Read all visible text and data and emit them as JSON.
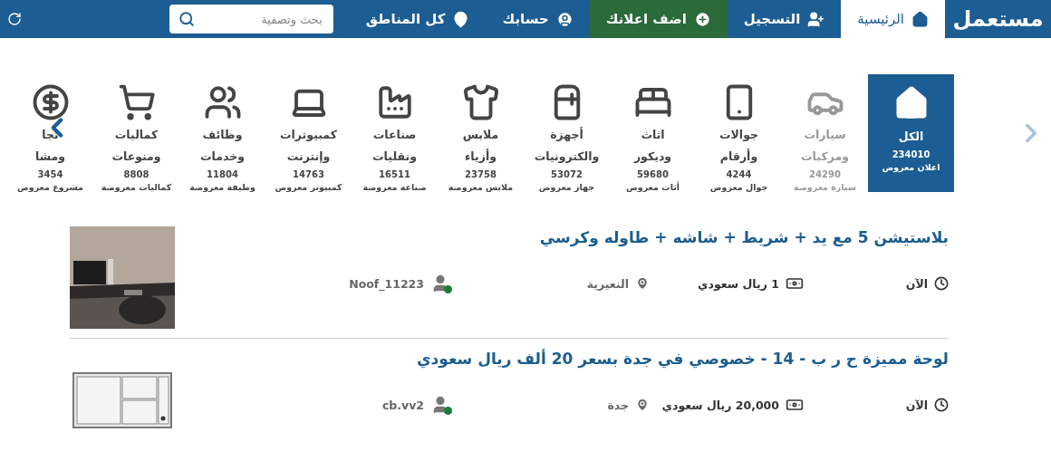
{
  "navbar": {
    "logo": "مستعمل",
    "items": [
      {
        "kind": "home",
        "label": "الرئيسية",
        "selected": true
      },
      {
        "kind": "register",
        "label": "التسجيل",
        "selected": false
      },
      {
        "kind": "add",
        "label": "اضف اعلانك",
        "selected": false
      },
      {
        "kind": "account",
        "label": "حسابك",
        "selected": false
      },
      {
        "kind": "region",
        "label": "كل المناطق",
        "selected": false
      }
    ],
    "search": {
      "placeholder": "بحث وتصفية"
    }
  },
  "categories": [
    {
      "kind": "home",
      "lines": [
        "الكل"
      ],
      "count": "234010",
      "unit": "اعلان معروض",
      "selected": true,
      "hovered": false
    },
    {
      "kind": "car",
      "lines": [
        "سيارات",
        "ومركبات"
      ],
      "count": "24290",
      "unit": "سيارة معروضة",
      "selected": false,
      "hovered": true
    },
    {
      "kind": "phone",
      "lines": [
        "جوالات",
        "وأرقام"
      ],
      "count": "4244",
      "unit": "جوال معروض",
      "selected": false,
      "hovered": false
    },
    {
      "kind": "furniture",
      "lines": [
        "اثاث",
        "وديكور"
      ],
      "count": "59680",
      "unit": "أثاث معروض",
      "selected": false,
      "hovered": false
    },
    {
      "kind": "appliance",
      "lines": [
        "أجهزة",
        "والكترونيات"
      ],
      "count": "53072",
      "unit": "جهاز معروض",
      "selected": false,
      "hovered": false
    },
    {
      "kind": "clothes",
      "lines": [
        "ملابس",
        "وأزياء"
      ],
      "count": "23758",
      "unit": "ملابس معروضة",
      "selected": false,
      "hovered": false
    },
    {
      "kind": "factory",
      "lines": [
        "صناعات",
        "ونقليات"
      ],
      "count": "16511",
      "unit": "صناعة معروضة",
      "selected": false,
      "hovered": false
    },
    {
      "kind": "laptop",
      "lines": [
        "كمبيوترات",
        "وإنترنت"
      ],
      "count": "14763",
      "unit": "كمبيوتر معروض",
      "selected": false,
      "hovered": false
    },
    {
      "kind": "people",
      "lines": [
        "وظائف",
        "وخدمات"
      ],
      "count": "11804",
      "unit": "وظيفة معروضة",
      "selected": false,
      "hovered": false
    },
    {
      "kind": "cart",
      "lines": [
        "كماليات",
        "ومنوعات"
      ],
      "count": "8808",
      "unit": "كماليات معروضة",
      "selected": false,
      "hovered": false
    },
    {
      "kind": "money",
      "lines": [
        "تجا",
        "ومشا"
      ],
      "count": "3454",
      "unit": "مشروع معروض",
      "selected": false,
      "hovered": false
    }
  ],
  "listings": [
    {
      "title": "بلاستيشن 5 مع يد + شريط + شاشه + طاوله وكرسي",
      "time": "الآن",
      "price": "1 ريال سعودي",
      "location": "النعيرية",
      "user": "Noof_11223",
      "online": true
    },
    {
      "title": "لوحة مميزة ح ر ب - 14 - خصوصي في جدة بسعر 20 ألف ريال سعودي",
      "time": "الآن",
      "price": "20,000 ريال سعودي",
      "location": "جدة",
      "user": "cb.vv2",
      "online": true
    }
  ]
}
